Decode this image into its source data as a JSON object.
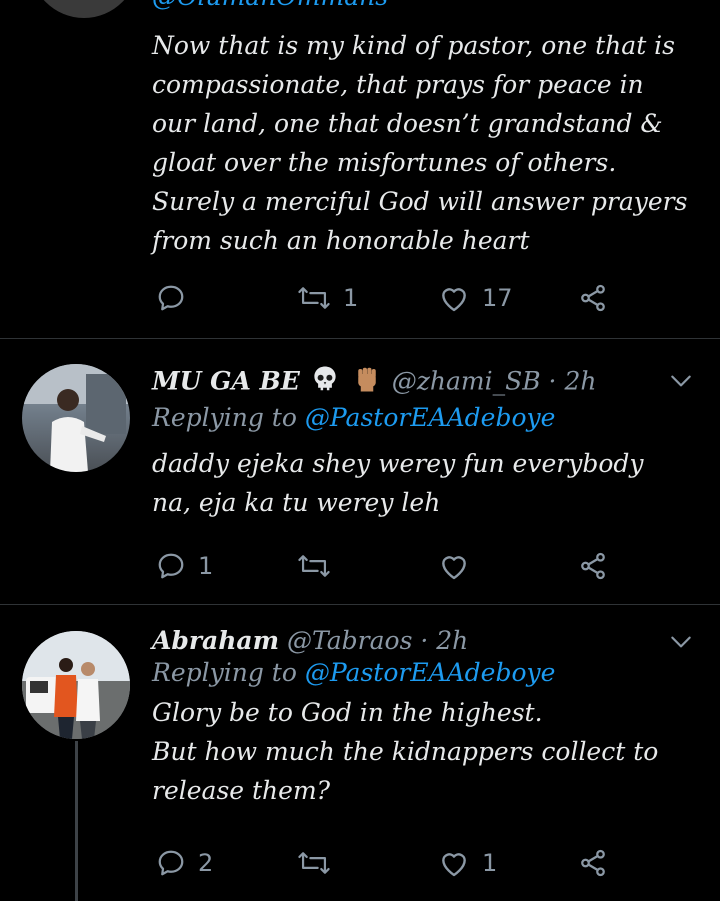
{
  "colors": {
    "background": "#000000",
    "text": "#e7e9ea",
    "muted": "#8b98a5",
    "link": "#1d9bf0",
    "divider": "#2f3336"
  },
  "tweets": [
    {
      "top_handle_fragment": "@OlumanOmmans",
      "body": "Now that is my kind of pastor, one that is compassionate, that prays for peace in our land, one that doesn’t grandstand & gloat over the misfortunes of others. Surely a merciful God will answer prayers from such an honorable heart",
      "actions": {
        "reply": "",
        "retweet": "1",
        "like": "17"
      }
    },
    {
      "display_name": "MU GA BE",
      "emojis": [
        "skull-icon",
        "raised-fist-icon"
      ],
      "handle": "@zhami_SB",
      "dot": "·",
      "time": "2h",
      "replying_prefix": "Replying to ",
      "replying_to": "@PastorEAAdeboye",
      "body": "daddy ejeka shey werey fun everybody na, eja ka tu werey leh",
      "actions": {
        "reply": "1",
        "retweet": "",
        "like": ""
      }
    },
    {
      "display_name": "Abraham",
      "handle": "@Tabraos",
      "dot": "·",
      "time": "2h",
      "replying_prefix": "Replying to ",
      "replying_to": "@PastorEAAdeboye",
      "body": "Glory be to God in the highest.\n But how much the kidnappers collect to release them?",
      "actions": {
        "reply": "2",
        "retweet": "",
        "like": "1"
      }
    }
  ]
}
